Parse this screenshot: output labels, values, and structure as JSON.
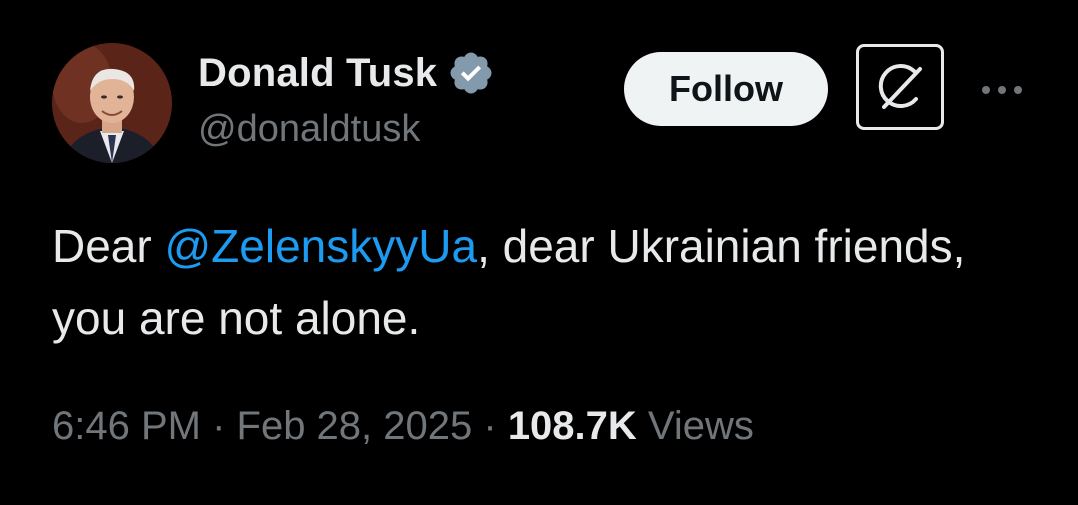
{
  "author": {
    "display_name": "Donald Tusk",
    "handle": "@donaldtusk",
    "verified_badge_icon": "verified-badge-icon",
    "verified_badge_color": "#829aab"
  },
  "actions": {
    "follow_label": "Follow",
    "grok_icon": "grok-icon",
    "more_icon": "more-icon"
  },
  "tweet": {
    "text_before_mention": "Dear ",
    "mention": "@ZelenskyyUa",
    "text_after_mention": ", dear Ukrainian friends, you are not alone."
  },
  "meta": {
    "time": "6:46 PM",
    "separator": " · ",
    "date": "Feb 28, 2025",
    "views_count": "108.7K",
    "views_label": "Views"
  },
  "colors": {
    "background": "#000000",
    "text_primary": "#e7e9ea",
    "text_secondary": "#71767b",
    "link": "#1d9bf0",
    "button_bg": "#eff3f4"
  }
}
